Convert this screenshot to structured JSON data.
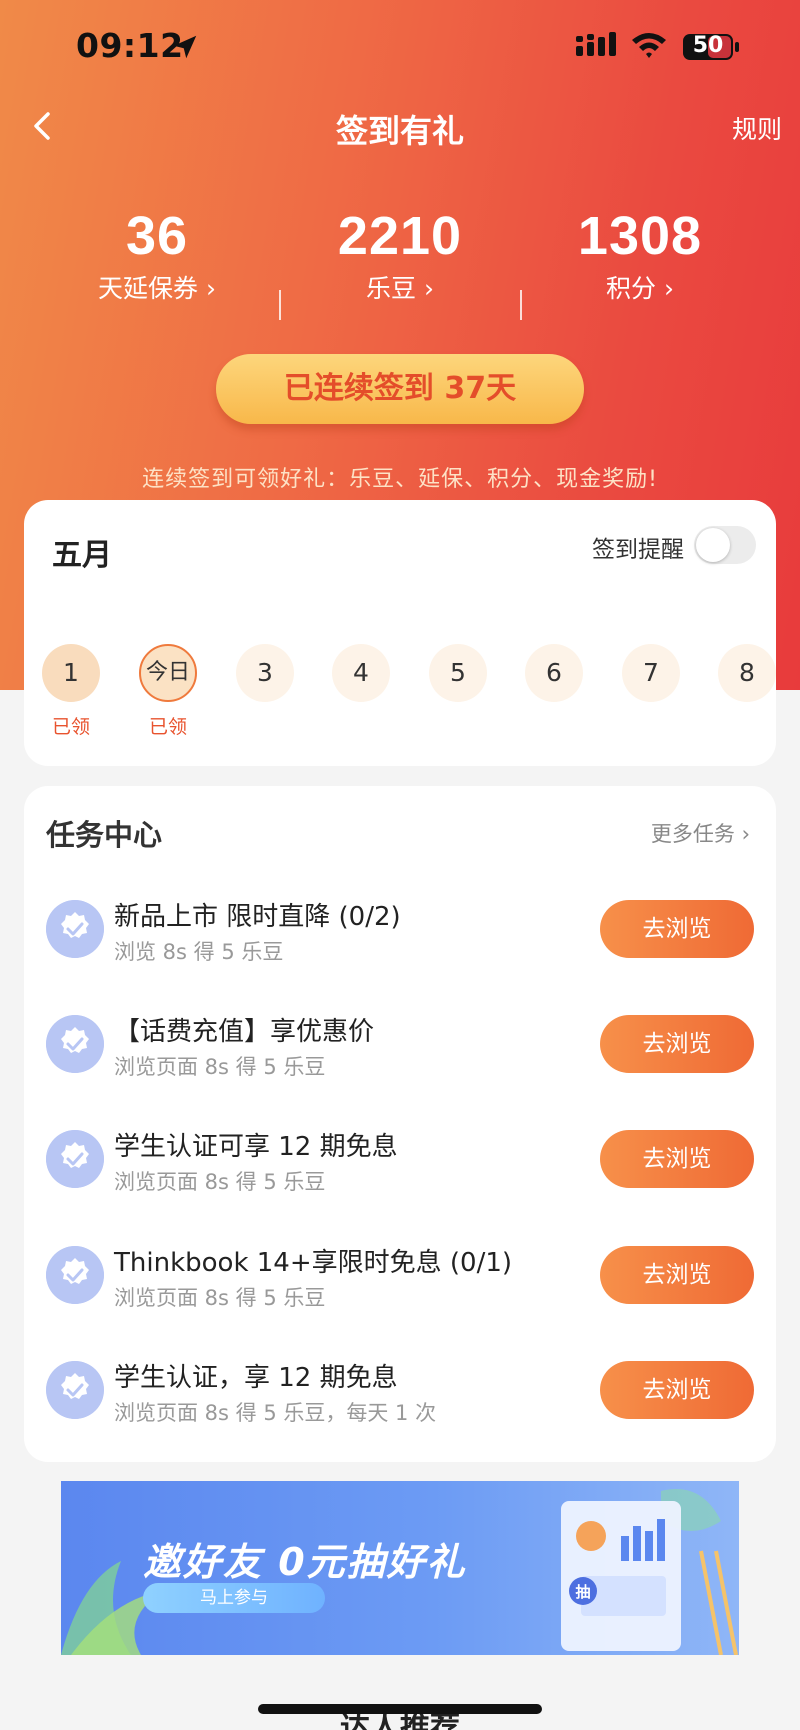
{
  "status_bar": {
    "time": "09:12",
    "battery": "50"
  },
  "nav": {
    "title": "签到有礼",
    "rules": "规则"
  },
  "stats": [
    {
      "value": "36",
      "label": "天延保券 ›"
    },
    {
      "value": "2210",
      "label": "乐豆 ›"
    },
    {
      "value": "1308",
      "label": "积分 ›"
    }
  ],
  "streak_button": "已连续签到 37天",
  "promo_text": "连续签到可领好礼：乐豆、延保、积分、现金奖励!",
  "calendar": {
    "month": "五月",
    "reminder_label": "签到提醒",
    "reminder_on": false,
    "days": [
      {
        "label": "1",
        "note": "已领"
      },
      {
        "label": "今日",
        "note": "已领"
      },
      {
        "label": "3",
        "note": ""
      },
      {
        "label": "4",
        "note": ""
      },
      {
        "label": "5",
        "note": ""
      },
      {
        "label": "6",
        "note": ""
      },
      {
        "label": "7",
        "note": ""
      },
      {
        "label": "8",
        "note": ""
      }
    ]
  },
  "tasks": {
    "title": "任务中心",
    "more": "更多任务 ›",
    "items": [
      {
        "title": "新品上市 限时直降 (0/2)",
        "subtitle": "浏览 8s 得 5 乐豆",
        "button": "去浏览"
      },
      {
        "title": "【话费充值】享优惠价",
        "subtitle": "浏览页面 8s 得 5 乐豆",
        "button": "去浏览"
      },
      {
        "title": "学生认证可享 12 期免息",
        "subtitle": "浏览页面 8s 得 5 乐豆",
        "button": "去浏览"
      },
      {
        "title": "Thinkbook 14+享限时免息 (0/1)",
        "subtitle": "浏览页面 8s 得 5 乐豆",
        "button": "去浏览"
      },
      {
        "title": "学生认证，享 12 期免息",
        "subtitle": "浏览页面 8s 得 5 乐豆，每天 1 次",
        "button": "去浏览"
      }
    ]
  },
  "banner": {
    "title": "邀好友 0元抽好礼",
    "button": "马上参与",
    "badge": "抽"
  },
  "next_section_title": "达人推荐",
  "colors": {
    "hero_start": "#f08a48",
    "hero_end": "#e83b3c",
    "accent": "#ef6a35",
    "banner": "#6c9bf4"
  }
}
